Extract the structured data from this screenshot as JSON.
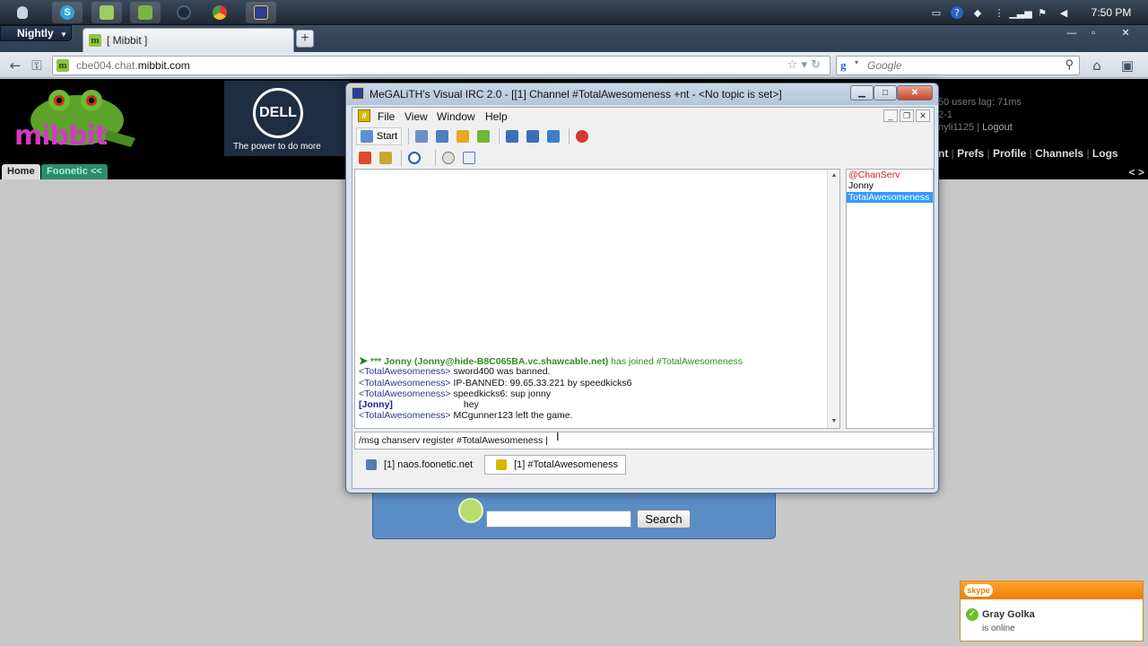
{
  "os": {
    "clock": "7:50 PM",
    "taskbar_icons": [
      "finder-icon",
      "skype-icon",
      "notes-icon",
      "pin-icon",
      "ball-icon",
      "chrome-icon",
      "irc-app-icon"
    ],
    "tray_icons": [
      "battery-icon",
      "help-icon",
      "dropbox-icon",
      "signal-icon",
      "wifi-icon",
      "flag-icon",
      "volume-icon"
    ]
  },
  "browser": {
    "menu_button": "Nightly",
    "tab_title": "[ Mibbit ]",
    "tab_favicon": "m",
    "url_prefix": "cbe004.chat.",
    "url_domain": "mibbit.com",
    "search_placeholder": "Google",
    "new_tab_label": "+"
  },
  "mibbit": {
    "logo_text": "mibbit",
    "ad_brand": "DELL",
    "ad_tagline": "The power to do more",
    "users_line": "50 users lag: 71ms",
    "users_line2": "2-1",
    "user_line": "nyli1125 | ",
    "logout": "Logout",
    "menu": [
      "nt",
      "Prefs",
      "Profile",
      "Channels",
      "Logs"
    ],
    "arrows": "< >",
    "tab_home": "Home",
    "tab_foonetic": "Foonetic <<",
    "search_button": "Search"
  },
  "irc": {
    "title": "MeGALiTH's Visual IRC 2.0 - [[1] Channel #TotalAwesomeness +nt - <No topic is set>]",
    "menus": [
      "File",
      "View",
      "Window",
      "Help"
    ],
    "start_label": "Start",
    "chat": {
      "join_prefix": "*** Jonny (Jonny@",
      "join_host": "hide-B8C065BA.vc.shawcable.net)",
      "join_suffix": " has joined #TotalAwesomeness",
      "lines": [
        {
          "nick": "<TotalAwesomeness>",
          "text": "sword400 was banned."
        },
        {
          "nick": "<TotalAwesomeness>",
          "text": "IP-BANNED: 99.65.33.221 by speedkicks6"
        },
        {
          "nick": "<TotalAwesomeness>",
          "text": "speedkicks6: sup jonny"
        },
        {
          "nick": "[Jonny]",
          "text": "hey"
        },
        {
          "nick": "<TotalAwesomeness>",
          "text": "MCgunner123 left the game."
        }
      ]
    },
    "nicklist": [
      "@ChanServ",
      "Jonny",
      "TotalAwesomeness"
    ],
    "input_value": "/msg chanserv register #TotalAwesomeness |",
    "window_tabs": [
      "[1] naos.foonetic.net",
      "[1] #TotalAwesomeness"
    ]
  },
  "skype": {
    "brand": "skype",
    "contact": "Gray Golka",
    "status": "is online",
    "accent": "#f07c00"
  }
}
